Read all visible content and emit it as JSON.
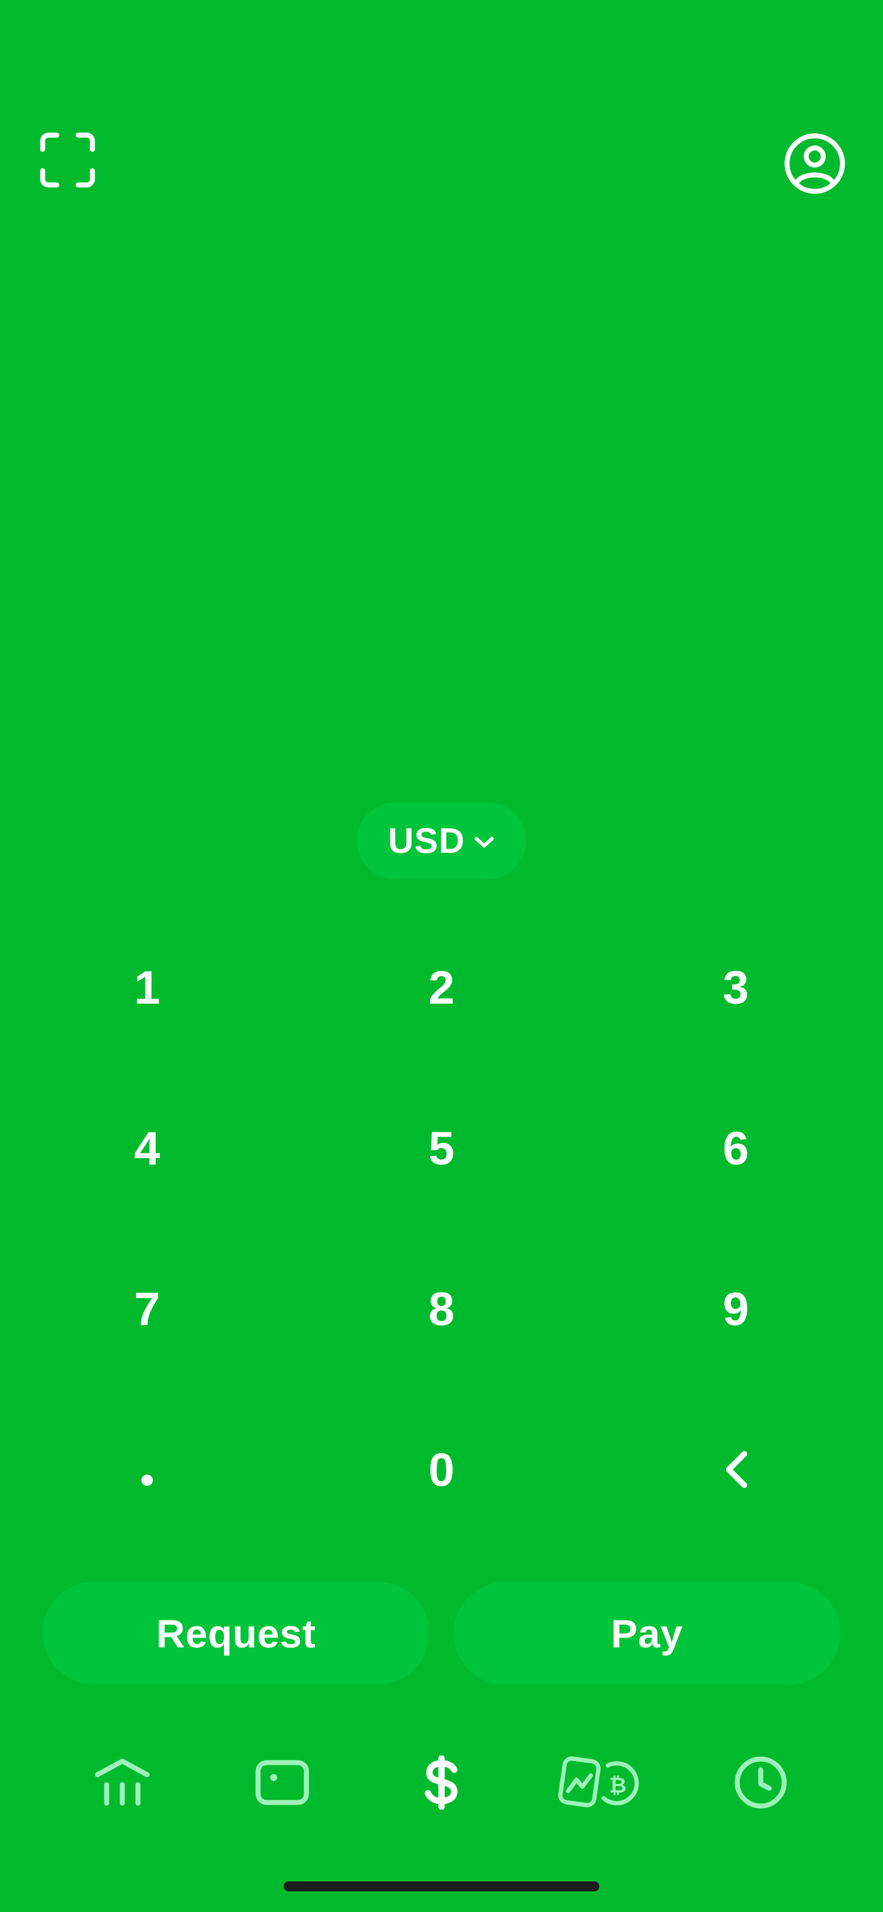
{
  "colors": {
    "background": "#00BA2E",
    "pill": "#00C43A",
    "icon_active": "#FFFFFF",
    "icon_inactive": "#9EF2B8"
  },
  "header": {
    "scan_icon": "scan-qr",
    "profile_icon": "profile-circle"
  },
  "currency": {
    "label": "USD",
    "icon": "chevron-down"
  },
  "keypad": {
    "keys": [
      "1",
      "2",
      "3",
      "4",
      "5",
      "6",
      "7",
      "8",
      "9",
      ".",
      "0",
      "backspace"
    ]
  },
  "actions": {
    "request_label": "Request",
    "pay_label": "Pay"
  },
  "tabbar": {
    "items": [
      {
        "icon": "home-bank",
        "active": false
      },
      {
        "icon": "card",
        "active": false
      },
      {
        "icon": "dollar",
        "active": true
      },
      {
        "icon": "investing-bitcoin",
        "active": false
      },
      {
        "icon": "activity-clock",
        "active": false
      }
    ]
  }
}
